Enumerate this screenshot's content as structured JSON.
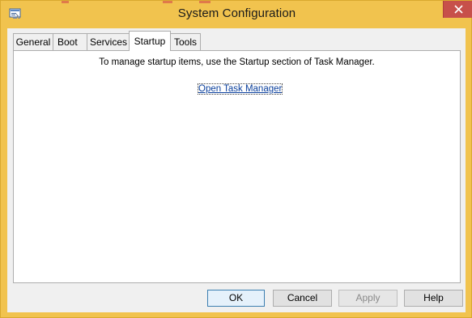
{
  "window": {
    "title": "System Configuration",
    "frame_color": "#f1c34e",
    "close_color": "#c7504a"
  },
  "icons": {
    "app": "msconfig-icon",
    "close": "close-icon"
  },
  "tabs": [
    {
      "label": "General",
      "selected": false
    },
    {
      "label": "Boot",
      "selected": false
    },
    {
      "label": "Services",
      "selected": false
    },
    {
      "label": "Startup",
      "selected": true
    },
    {
      "label": "Tools",
      "selected": false
    }
  ],
  "startup_tab": {
    "message": "To manage startup items, use the Startup section of Task Manager.",
    "link_text": "Open Task Manager",
    "link_color": "#0a3f9c"
  },
  "buttons": {
    "ok": "OK",
    "cancel": "Cancel",
    "apply": "Apply",
    "help": "Help"
  },
  "states": {
    "apply_enabled": false,
    "default_button": "OK"
  }
}
